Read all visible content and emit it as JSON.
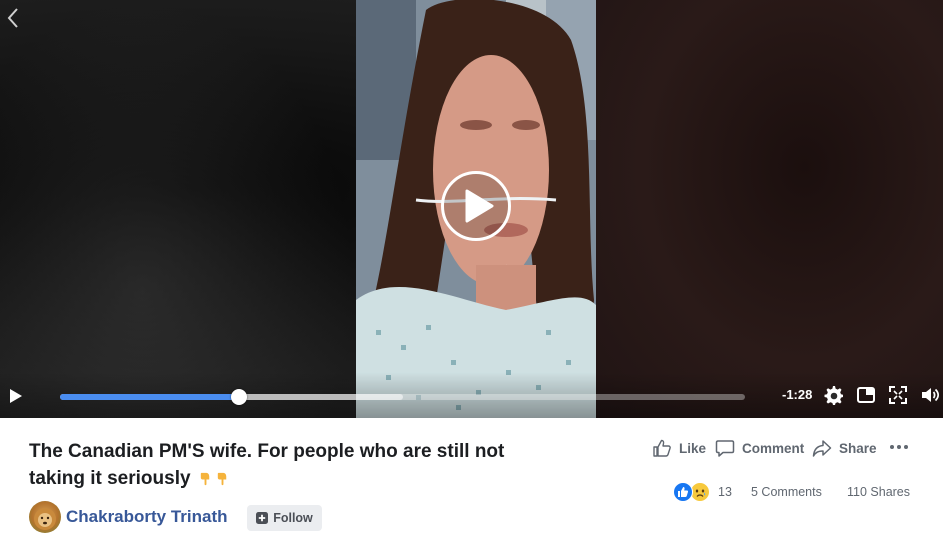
{
  "player": {
    "time_remaining": "-1:28",
    "progress_fraction": 0.262,
    "buffered_fraction": 0.5,
    "accent_color": "#4a8df0"
  },
  "post": {
    "title": "The Canadian PM'S wife. For people who are still not taking it seriously",
    "title_emoji": "backhand-index-pointing-down x2",
    "author": "Chakraborty Trinath",
    "follow_label": "Follow"
  },
  "actions": {
    "like_label": "Like",
    "comment_label": "Comment",
    "share_label": "Share"
  },
  "stats": {
    "reaction_count": "13",
    "comments": "5 Comments",
    "shares": "110 Shares"
  },
  "icons": [
    "back-chevron-icon",
    "play-icon",
    "settings-gear-icon",
    "picture-in-picture-icon",
    "fullscreen-icon",
    "volume-icon",
    "thumbs-up-icon",
    "comment-bubble-icon",
    "share-arrow-icon",
    "more-dots-icon",
    "plus-icon"
  ]
}
